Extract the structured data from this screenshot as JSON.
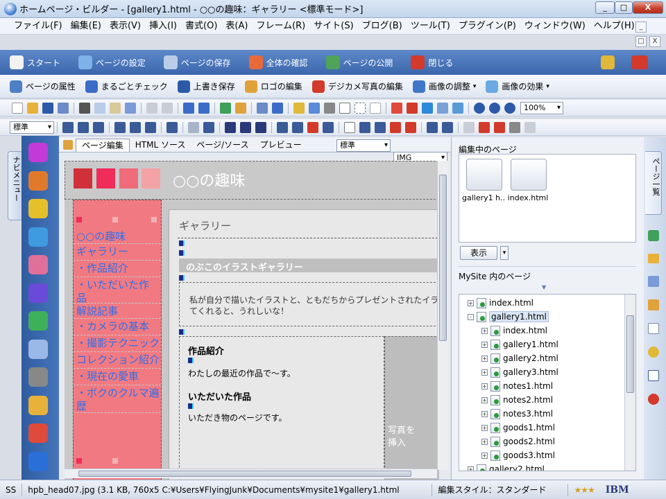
{
  "window": {
    "title": "ホームページ・ビルダー - [gallery1.html - ○○の趣味：ギャラリー <標準モード>]",
    "minimize_label": "_",
    "maximize_label": "□",
    "close_label": "X"
  },
  "menu": {
    "items": [
      {
        "label": "ファイル(F)"
      },
      {
        "label": "編集(E)"
      },
      {
        "label": "表示(V)"
      },
      {
        "label": "挿入(I)"
      },
      {
        "label": "書式(O)"
      },
      {
        "label": "表(A)"
      },
      {
        "label": "フレーム(R)"
      },
      {
        "label": "サイト(S)"
      },
      {
        "label": "ブログ(B)"
      },
      {
        "label": "ツール(T)"
      },
      {
        "label": "プラグイン(P)"
      },
      {
        "label": "ウィンドウ(W)"
      },
      {
        "label": "ヘルプ(H)"
      }
    ]
  },
  "main_toolbar": {
    "items": [
      {
        "label": "スタート",
        "icon": "start-icon",
        "color": "#f2f2f2"
      },
      {
        "label": "ページの設定",
        "icon": "page-settings-icon",
        "color": "#7fb2e8"
      },
      {
        "label": "ページの保存",
        "icon": "save-page-icon",
        "color": "#b9cce8"
      },
      {
        "label": "全体の確認",
        "icon": "check-all-icon",
        "color": "#e86a3a"
      },
      {
        "label": "ページの公開",
        "icon": "publish-icon",
        "color": "#4fa45a"
      },
      {
        "label": "閉じる",
        "icon": "close-page-icon",
        "color": "#d33a2c"
      }
    ]
  },
  "task_toolbar": {
    "items": [
      {
        "label": "ページの属性",
        "icon": "page-attributes-icon",
        "color": "#4f7fc5"
      },
      {
        "label": "まるごとチェック",
        "icon": "full-check-icon",
        "color": "#3b6cc8"
      },
      {
        "label": "上書き保存",
        "icon": "overwrite-save-icon",
        "color": "#2c5aa8"
      },
      {
        "label": "ロゴの編集",
        "icon": "logo-edit-icon",
        "color": "#e0a23a"
      },
      {
        "label": "デジカメ写真の編集",
        "icon": "photo-edit-icon",
        "color": "#d23a2a"
      },
      {
        "label": "画像の調整",
        "icon": "image-adjust-icon",
        "color": "#3f78c9"
      },
      {
        "label": "画像の効果",
        "icon": "image-effect-icon",
        "color": "#6ba9e0"
      }
    ]
  },
  "format_toolbar": {
    "style_select": "標準",
    "zoom_value": "100%"
  },
  "left_tab": {
    "label": "ナビメニュー"
  },
  "nav_strip": {
    "icons": [
      {
        "icon": "font-a-icon",
        "color": "#c23ad8"
      },
      {
        "icon": "shapes-icon",
        "color": "#e07a2a"
      },
      {
        "icon": "link-icon",
        "color": "#e6c02a"
      },
      {
        "icon": "image-icon",
        "color": "#3f9ae0"
      },
      {
        "icon": "wave-icon",
        "color": "#e0709a"
      },
      {
        "icon": "frame-a-icon",
        "color": "#6a4ad8"
      },
      {
        "icon": "grid-icon",
        "color": "#3fb05a"
      },
      {
        "icon": "document-icon",
        "color": "#9ab8e8"
      },
      {
        "icon": "edit-pen-icon",
        "color": "#888888"
      },
      {
        "icon": "folder-icon",
        "color": "#e8b23a"
      },
      {
        "icon": "cubes-icon",
        "color": "#e04a3a"
      },
      {
        "icon": "plus-circle-icon",
        "color": "#2a6ed8"
      }
    ]
  },
  "editor": {
    "tabs": [
      {
        "label": "ページ編集",
        "active": true
      },
      {
        "label": "HTML ソース",
        "active": false
      },
      {
        "label": "ページ/ソース",
        "active": false
      },
      {
        "label": "プレビュー",
        "active": false
      }
    ],
    "style_select": "標準",
    "img_select": "IMG",
    "page": {
      "site_title": "○○の趣味",
      "nav_links": [
        {
          "label": "○○の趣味"
        },
        {
          "label": "ギャラリー"
        },
        {
          "label": "・作品紹介"
        },
        {
          "label": "・いただいた作"
        },
        {
          "label": "品"
        },
        {
          "label": "解説記事"
        },
        {
          "label": "・カメラの基本"
        },
        {
          "label": "・撮影テクニック"
        },
        {
          "label": "コレクション紹介"
        },
        {
          "label": "・現在の愛車"
        },
        {
          "label": "・ボクのクルマ遍"
        },
        {
          "label": "歴"
        }
      ],
      "content_title": "ギャラリー",
      "banner_text": "のぶこのイラストギャラリー",
      "intro_text": "私が自分で描いたイラストと、ともだちからプレゼントされたイラストを",
      "intro_text2": "てくれると、うれしいな！",
      "section1_title": "作品紹介",
      "section1_text": "わたしの最近の作品で～す。",
      "section2_title": "いただいた作品",
      "section2_text": "いただき物のページです。",
      "photo_placeholder": "写真を",
      "photo_placeholder2": "挿入"
    }
  },
  "side_panel": {
    "editing_title": "編集中のページ",
    "editing_files": [
      {
        "label": "gallery1 h..."
      },
      {
        "label": "index.html"
      }
    ],
    "display_button": "表示",
    "site_title": "MySite 内のページ",
    "tree": [
      {
        "label": "index.html",
        "level": 0,
        "expand": "+"
      },
      {
        "label": "gallery1.html",
        "level": 0,
        "expand": "-"
      },
      {
        "label": "index.html",
        "level": 1,
        "expand": "+"
      },
      {
        "label": "gallery1.html",
        "level": 1,
        "expand": "+"
      },
      {
        "label": "gallery2.html",
        "level": 1,
        "expand": "+"
      },
      {
        "label": "gallery3.html",
        "level": 1,
        "expand": "+"
      },
      {
        "label": "notes1.html",
        "level": 1,
        "expand": "+"
      },
      {
        "label": "notes2.html",
        "level": 1,
        "expand": "+"
      },
      {
        "label": "notes3.html",
        "level": 1,
        "expand": "+"
      },
      {
        "label": "goods1.html",
        "level": 1,
        "expand": "+"
      },
      {
        "label": "goods2.html",
        "level": 1,
        "expand": "+"
      },
      {
        "label": "goods3.html",
        "level": 1,
        "expand": "+"
      },
      {
        "label": "gallery2.html",
        "level": 0,
        "expand": "+"
      }
    ]
  },
  "right_tab": {
    "label": "ページ一覧"
  },
  "status_bar": {
    "mode": "SS",
    "file_info": "hpb_head07.jpg (3.1 KB, 760x5",
    "path": "C:¥Users¥FlyingJunk¥Documents¥mysite1¥gallery1.html",
    "edit_style": "編集スタイル：スタンダード",
    "brand": "IBM"
  }
}
